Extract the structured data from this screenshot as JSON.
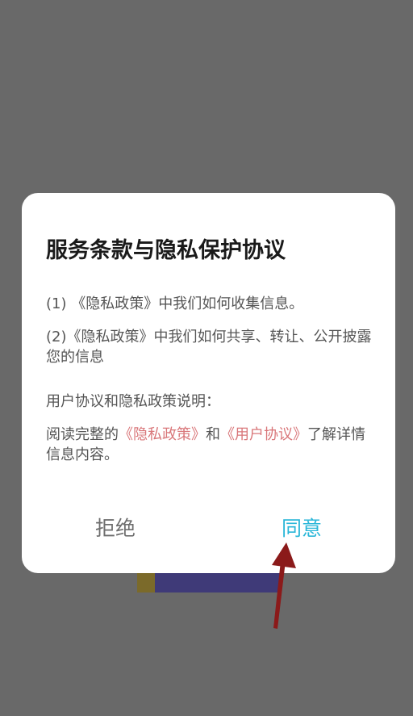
{
  "dialog": {
    "title": "服务条款与隐私保护协议",
    "item1": "(1) 《隐私政策》中我们如何收集信息。",
    "item2": "(2)《隐私政策》中我们如何共享、转让、公开披露您的信息",
    "note_heading": "用户协议和隐私政策说明：",
    "read_prefix": "阅读完整的",
    "privacy_link": "《隐私政策》",
    "and_text": "和",
    "terms_link": "《用户协议》",
    "read_suffix": "了解详情信息内容。",
    "reject_label": "拒绝",
    "agree_label": "同意"
  },
  "colors": {
    "overlay": "#696969",
    "link": "#d9777a",
    "agree": "#29b6d8",
    "arrow": "#8b1a1a"
  }
}
